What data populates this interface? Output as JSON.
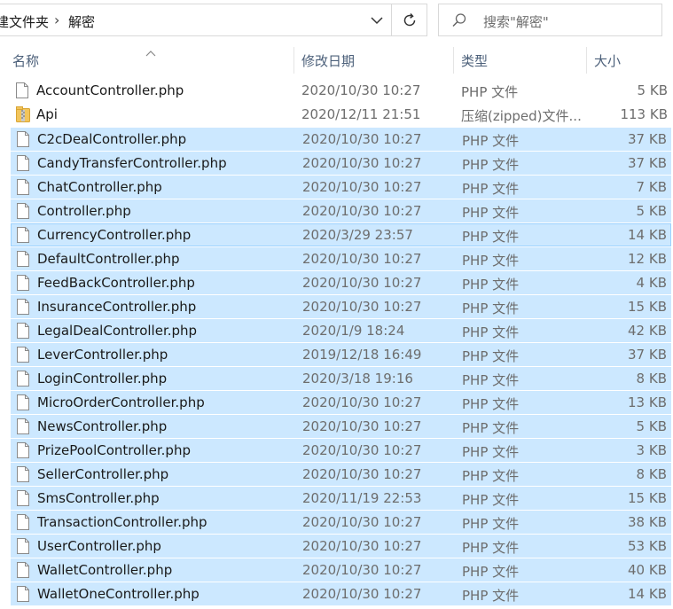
{
  "address": {
    "crumbs": [
      "建文件夹",
      "解密"
    ],
    "separator": "›"
  },
  "search": {
    "placeholder": "搜索\"解密\""
  },
  "columns": {
    "name": "名称",
    "date": "修改日期",
    "type": "类型",
    "size": "大小"
  },
  "files": [
    {
      "name": "AccountController.php",
      "date": "2020/10/30 10:27",
      "type": "PHP 文件",
      "size": "5 KB",
      "icon": "php-file-icon",
      "selected": false
    },
    {
      "name": "Api",
      "date": "2020/12/11 21:51",
      "type": "压缩(zipped)文件...",
      "size": "113 KB",
      "icon": "zip-folder-icon",
      "selected": false
    },
    {
      "name": "C2cDealController.php",
      "date": "2020/10/30 10:27",
      "type": "PHP 文件",
      "size": "37 KB",
      "icon": "php-file-icon",
      "selected": true
    },
    {
      "name": "CandyTransferController.php",
      "date": "2020/10/30 10:27",
      "type": "PHP 文件",
      "size": "37 KB",
      "icon": "php-file-icon",
      "selected": true
    },
    {
      "name": "ChatController.php",
      "date": "2020/10/30 10:27",
      "type": "PHP 文件",
      "size": "7 KB",
      "icon": "php-file-icon",
      "selected": true
    },
    {
      "name": "Controller.php",
      "date": "2020/10/30 10:27",
      "type": "PHP 文件",
      "size": "5 KB",
      "icon": "php-file-icon",
      "selected": true
    },
    {
      "name": "CurrencyController.php",
      "date": "2020/3/29 23:57",
      "type": "PHP 文件",
      "size": "14 KB",
      "icon": "php-file-icon",
      "selected": true,
      "focused": true
    },
    {
      "name": "DefaultController.php",
      "date": "2020/10/30 10:27",
      "type": "PHP 文件",
      "size": "12 KB",
      "icon": "php-file-icon",
      "selected": true
    },
    {
      "name": "FeedBackController.php",
      "date": "2020/10/30 10:27",
      "type": "PHP 文件",
      "size": "4 KB",
      "icon": "php-file-icon",
      "selected": true
    },
    {
      "name": "InsuranceController.php",
      "date": "2020/10/30 10:27",
      "type": "PHP 文件",
      "size": "15 KB",
      "icon": "php-file-icon",
      "selected": true
    },
    {
      "name": "LegalDealController.php",
      "date": "2020/1/9 18:24",
      "type": "PHP 文件",
      "size": "42 KB",
      "icon": "php-file-icon",
      "selected": true
    },
    {
      "name": "LeverController.php",
      "date": "2019/12/18 16:49",
      "type": "PHP 文件",
      "size": "37 KB",
      "icon": "php-file-icon",
      "selected": true
    },
    {
      "name": "LoginController.php",
      "date": "2020/3/18 19:16",
      "type": "PHP 文件",
      "size": "8 KB",
      "icon": "php-file-icon",
      "selected": true
    },
    {
      "name": "MicroOrderController.php",
      "date": "2020/10/30 10:27",
      "type": "PHP 文件",
      "size": "13 KB",
      "icon": "php-file-icon",
      "selected": true
    },
    {
      "name": "NewsController.php",
      "date": "2020/10/30 10:27",
      "type": "PHP 文件",
      "size": "5 KB",
      "icon": "php-file-icon",
      "selected": true
    },
    {
      "name": "PrizePoolController.php",
      "date": "2020/10/30 10:27",
      "type": "PHP 文件",
      "size": "3 KB",
      "icon": "php-file-icon",
      "selected": true
    },
    {
      "name": "SellerController.php",
      "date": "2020/10/30 10:27",
      "type": "PHP 文件",
      "size": "8 KB",
      "icon": "php-file-icon",
      "selected": true
    },
    {
      "name": "SmsController.php",
      "date": "2020/11/19 22:53",
      "type": "PHP 文件",
      "size": "15 KB",
      "icon": "php-file-icon",
      "selected": true
    },
    {
      "name": "TransactionController.php",
      "date": "2020/10/30 10:27",
      "type": "PHP 文件",
      "size": "38 KB",
      "icon": "php-file-icon",
      "selected": true
    },
    {
      "name": "UserController.php",
      "date": "2020/10/30 10:27",
      "type": "PHP 文件",
      "size": "53 KB",
      "icon": "php-file-icon",
      "selected": true
    },
    {
      "name": "WalletController.php",
      "date": "2020/10/30 10:27",
      "type": "PHP 文件",
      "size": "40 KB",
      "icon": "php-file-icon",
      "selected": true
    },
    {
      "name": "WalletOneController.php",
      "date": "2020/10/30 10:27",
      "type": "PHP 文件",
      "size": "14 KB",
      "icon": "php-file-icon",
      "selected": true
    }
  ],
  "colors": {
    "selection": "#cce8ff",
    "focus_border": "#99d1ff",
    "header_text": "#4c607a",
    "meta_text": "#6d6d6d"
  }
}
